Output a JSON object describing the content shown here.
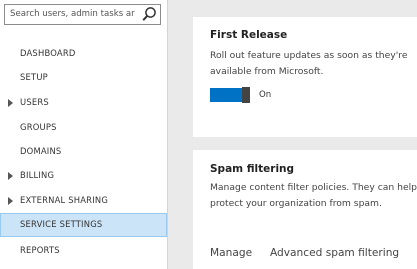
{
  "search": {
    "placeholder": "Search users, admin tasks ar",
    "icon": "search-icon"
  },
  "sidebar": {
    "items": [
      {
        "label": "DASHBOARD",
        "expandable": false,
        "active": false
      },
      {
        "label": "SETUP",
        "expandable": false,
        "active": false
      },
      {
        "label": "USERS",
        "expandable": true,
        "active": false
      },
      {
        "label": "GROUPS",
        "expandable": false,
        "active": false
      },
      {
        "label": "DOMAINS",
        "expandable": false,
        "active": false
      },
      {
        "label": "BILLING",
        "expandable": true,
        "active": false
      },
      {
        "label": "EXTERNAL SHARING",
        "expandable": true,
        "active": false
      },
      {
        "label": "SERVICE SETTINGS",
        "expandable": false,
        "active": true
      },
      {
        "label": "REPORTS",
        "expandable": false,
        "active": false
      }
    ]
  },
  "first_release": {
    "title": "First Release",
    "description": "Roll out feature updates as soon as they're available from Microsoft.",
    "toggle_state": "On",
    "toggle_on": true
  },
  "spam_filtering": {
    "title": "Spam filtering",
    "description": "Manage content filter policies. They can help protect your organization from spam.",
    "links": [
      "Manage",
      "Advanced spam filtering"
    ]
  },
  "colors": {
    "accent": "#0072c6",
    "active_nav_bg": "#cce4f7",
    "active_nav_border": "#99c9ef",
    "page_bg": "#eaeaea"
  }
}
